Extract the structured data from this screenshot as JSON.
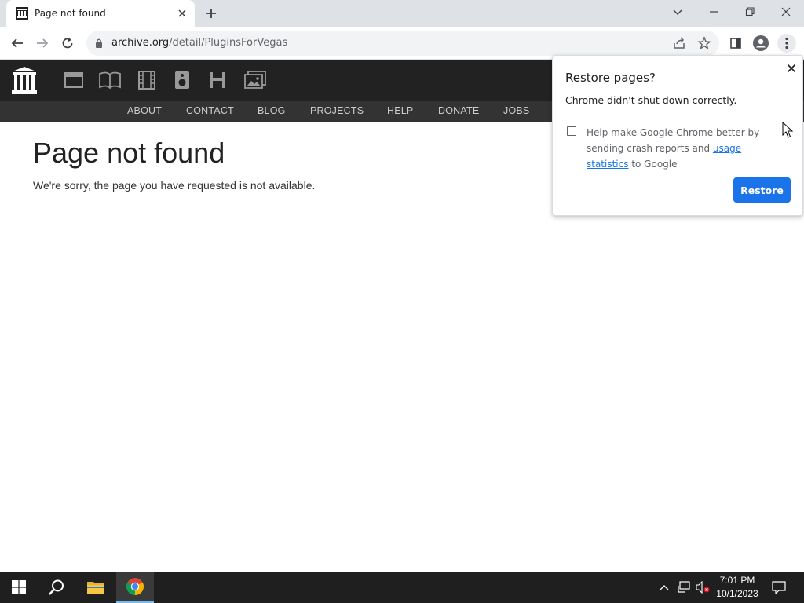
{
  "browser": {
    "tab_title": "Page not found",
    "url_host": "archive.org",
    "url_path": "/detail/PluginsForVegas"
  },
  "site": {
    "nav": [
      "ABOUT",
      "CONTACT",
      "BLOG",
      "PROJECTS",
      "HELP",
      "DONATE",
      "JOBS"
    ],
    "media_icons": [
      "web-icon",
      "texts-icon",
      "video-icon",
      "audio-icon",
      "software-icon",
      "images-icon"
    ]
  },
  "page": {
    "title": "Page not found",
    "message": "We're sorry, the page you have requested is not available."
  },
  "restore_bubble": {
    "title": "Restore pages?",
    "subtitle": "Chrome didn't shut down correctly.",
    "checkbox_text_before": "Help make Google Chrome better by sending crash reports and ",
    "checkbox_link": "usage statistics",
    "checkbox_text_after": " to Google",
    "checked": false,
    "button": "Restore"
  },
  "taskbar": {
    "time": "7:01 PM",
    "date": "10/1/2023"
  },
  "colors": {
    "accent": "#1a73e8",
    "site_header": "#222222",
    "site_nav": "#333333",
    "taskbar": "#1f1f1f"
  }
}
